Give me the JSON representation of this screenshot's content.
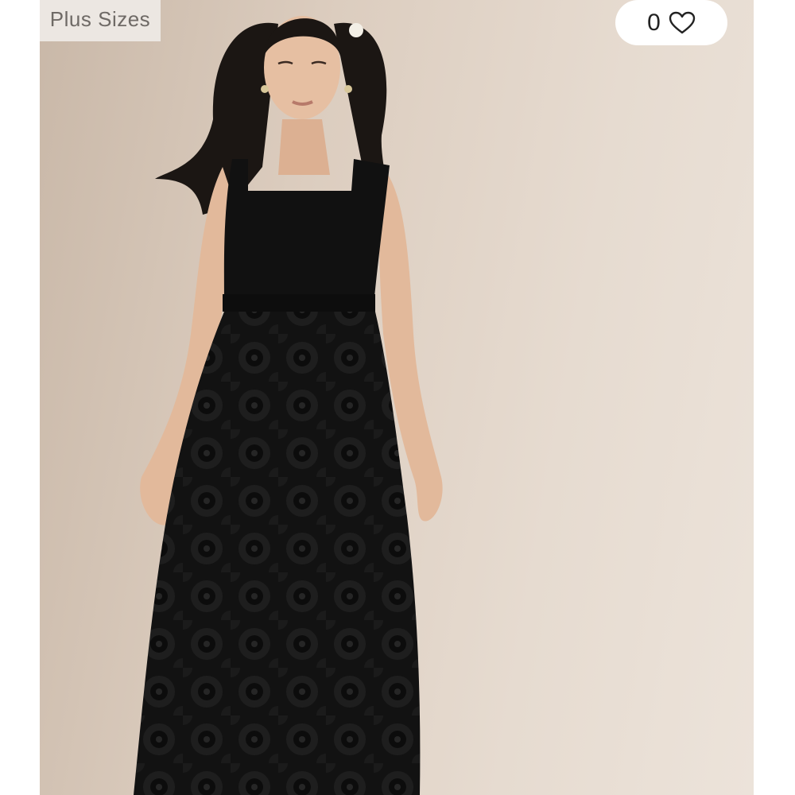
{
  "badge": {
    "label": "Plus Sizes"
  },
  "favorite": {
    "count": "0",
    "icon": "heart-outline-icon"
  },
  "product_image": {
    "icon": "product-photo"
  },
  "colors": {
    "background_left": "#c9b8a8",
    "background_right": "#ece3da",
    "badge_bg": "#ece7e2",
    "badge_text": "#6f6a66",
    "dress": "#111111",
    "skin": "#e2b99b",
    "hair": "#1b1613"
  }
}
